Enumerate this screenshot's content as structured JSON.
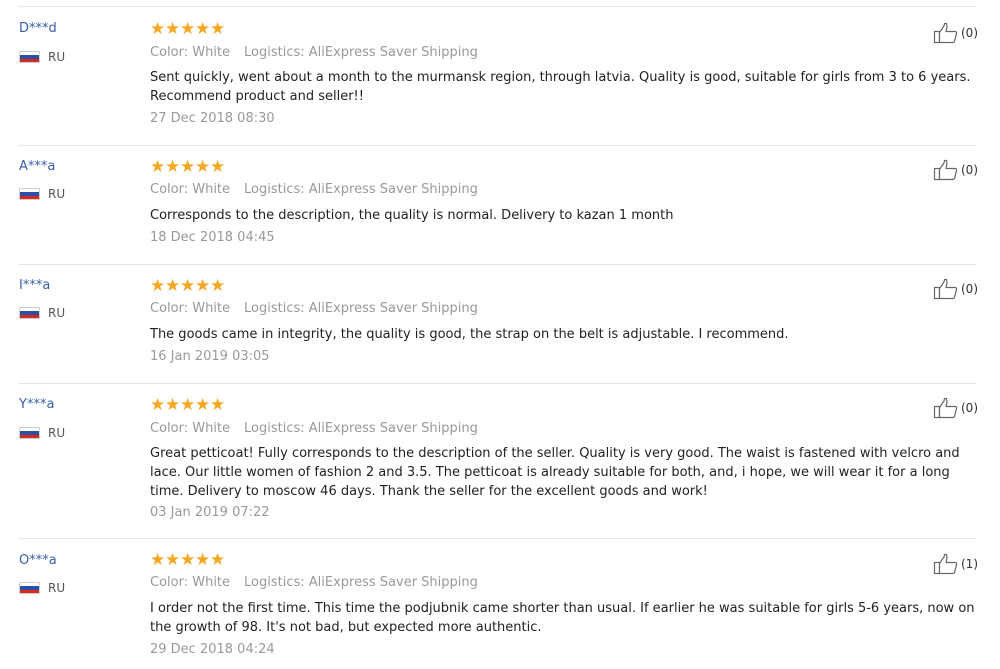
{
  "reviews": [
    {
      "user": "D***d",
      "country": "RU",
      "stars": [
        "★",
        "★",
        "★",
        "★",
        "★"
      ],
      "color_label": "Color: White",
      "shipping_label": "Logistics: AliExpress Saver Shipping",
      "text": "Sent quickly, went about a month to the murmansk region, through latvia. Quality is good, suitable for girls from 3 to 6 years. Recommend product and seller!!",
      "date": "27 Dec 2018 08:30",
      "helpful": "(0)"
    },
    {
      "user": "A***a",
      "country": "RU",
      "stars": [
        "★",
        "★",
        "★",
        "★",
        "★"
      ],
      "color_label": "Color: White",
      "shipping_label": "Logistics: AliExpress Saver Shipping",
      "text": "Corresponds to the description, the quality is normal. Delivery to kazan 1 month",
      "date": "18 Dec 2018 04:45",
      "helpful": "(0)"
    },
    {
      "user": "I***a",
      "country": "RU",
      "stars": [
        "★",
        "★",
        "★",
        "★",
        "★"
      ],
      "color_label": "Color: White",
      "shipping_label": "Logistics: AliExpress Saver Shipping",
      "text": "The goods came in integrity, the quality is good, the strap on the belt is adjustable. I recommend.",
      "date": "16 Jan 2019 03:05",
      "helpful": "(0)"
    },
    {
      "user": "Y***a",
      "country": "RU",
      "stars": [
        "★",
        "★",
        "★",
        "★",
        "★"
      ],
      "color_label": "Color: White",
      "shipping_label": "Logistics: AliExpress Saver Shipping",
      "text": "Great petticoat! Fully corresponds to the description of the seller. Quality is very good. The waist is fastened with velcro and lace. Our little women of fashion 2 and 3.5. The petticoat is already suitable for both, and, i hope, we will wear it for a long time. Delivery to moscow 46 days. Thank the seller for the excellent goods and work!",
      "date": "03 Jan 2019 07:22",
      "helpful": "(0)"
    },
    {
      "user": "O***a",
      "country": "RU",
      "stars": [
        "★",
        "★",
        "★",
        "★",
        "★"
      ],
      "color_label": "Color: White",
      "shipping_label": "Logistics: AliExpress Saver Shipping",
      "text": "I order not the first time. This time the podjubnik came shorter than usual. If earlier he was suitable for girls 5-6 years, now on the growth of 98. It's not bad, but expected more authentic.",
      "date": "29 Dec 2018 04:24",
      "helpful": "(1)"
    }
  ],
  "colors": {
    "star": "#f5a623",
    "username": "#3a5ea8",
    "muted": "#999999",
    "text": "#222222",
    "divider": "#e6e6e6"
  },
  "icons": {
    "helpful": "thumbs-up-icon",
    "flag": "russia-flag-icon",
    "star": "star-icon"
  }
}
